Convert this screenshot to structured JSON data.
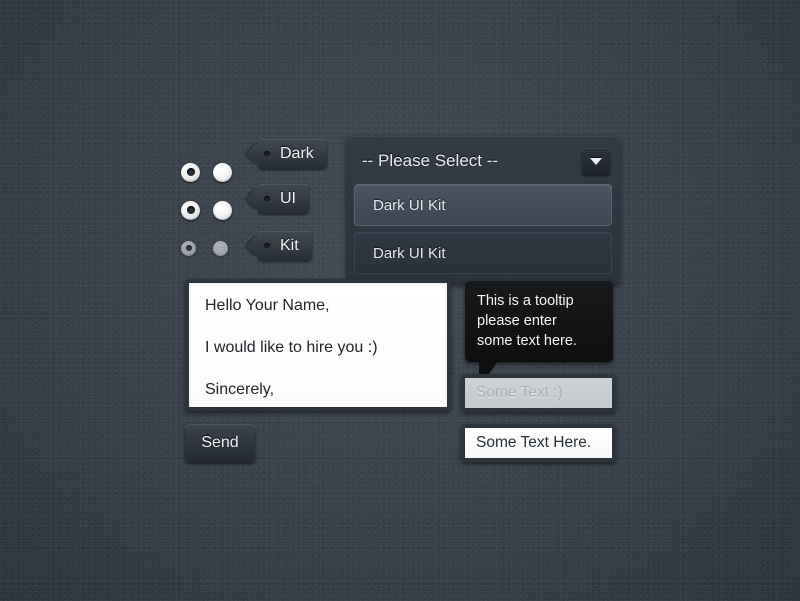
{
  "background": {
    "color": "#3b434c",
    "texture": "dark-slate-leather"
  },
  "choices": {
    "rows": [
      {
        "radio": {
          "name": "radio-selected",
          "state": "selected",
          "enabled": true
        },
        "box": {
          "name": "radio-unselected",
          "state": "unselected",
          "enabled": true
        },
        "tag_label": "Dark"
      },
      {
        "radio": {
          "name": "radio-selected",
          "state": "selected",
          "enabled": true
        },
        "box": {
          "name": "radio-unselected",
          "state": "unselected",
          "enabled": true
        },
        "tag_label": "UI"
      },
      {
        "radio": {
          "name": "radio-selected-disabled",
          "state": "selected",
          "enabled": false
        },
        "box": {
          "name": "radio-unselected-disabled",
          "state": "unselected",
          "enabled": false
        },
        "tag_label": "Kit"
      }
    ]
  },
  "select": {
    "header_label": "-- Please Select --",
    "arrow_icon": "chevron-down-icon",
    "options": [
      {
        "label": "Dark UI Kit",
        "highlighted": true
      },
      {
        "label": "Dark UI Kit",
        "highlighted": false
      }
    ]
  },
  "textarea": {
    "lines": [
      "Hello Your Name,",
      "I would like to hire you :)",
      "Sincerely,"
    ]
  },
  "send_button": {
    "label": "Send"
  },
  "tooltip": {
    "lines": [
      "This is a tooltip",
      "please enter",
      "some text here."
    ]
  },
  "inputs": {
    "disabled_field": {
      "value": "Some Text :)",
      "placeholder": "Some Text :)",
      "enabled": false
    },
    "filled_field": {
      "value": "Some Text Here.",
      "placeholder": "Some Text Here.",
      "enabled": true
    }
  },
  "colors": {
    "background": "#3b434c",
    "panel": "#2f373f",
    "tag": "#343b43",
    "highlight": "#4a5462",
    "tooltip": "#111315",
    "text_light": "#eef1f4",
    "text_dark": "#21262b",
    "disabled_field": "#c8ccd0"
  }
}
